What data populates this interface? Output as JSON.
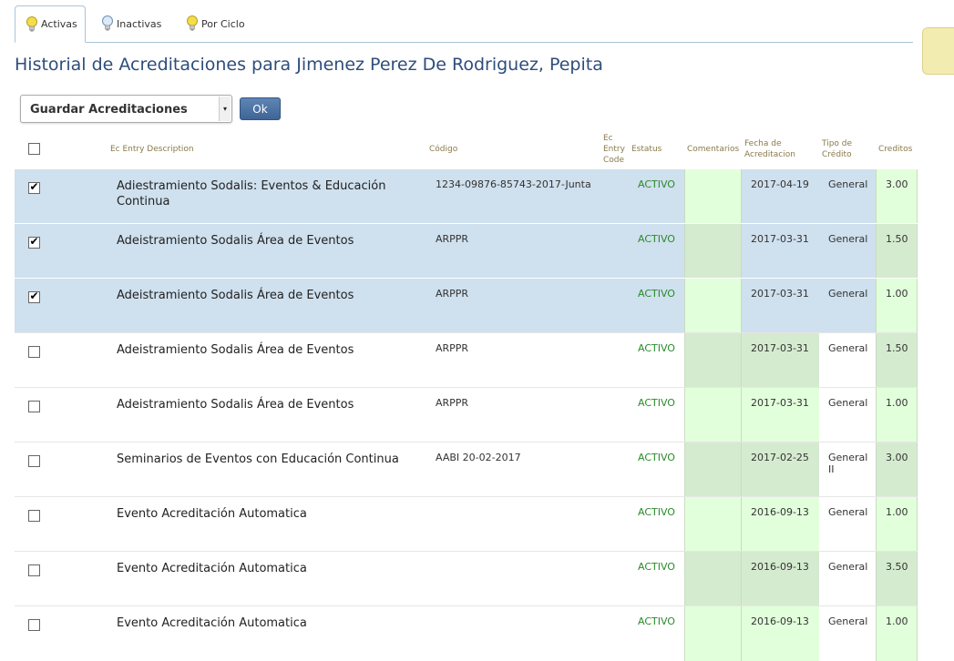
{
  "tabs": [
    {
      "label": "Activas",
      "active": true
    },
    {
      "label": "Inactivas",
      "active": false
    },
    {
      "label": "Por Ciclo",
      "active": false
    }
  ],
  "page_title": "Historial de Acreditaciones para Jimenez Perez De Rodriguez, Pepita",
  "action_select": {
    "value": "Guardar Acreditaciones"
  },
  "ok_label": "Ok",
  "columns": {
    "description": "Ec Entry Description",
    "code": "Código",
    "entry_code": "Ec Entry Code",
    "status": "Estatus",
    "comments": "Comentarios",
    "date": "Fecha de Acreditacion",
    "type": "Tipo de Crédito",
    "credits": "Creditos"
  },
  "colors": {
    "selected_row": "#cfe0ee",
    "green_light": "#e2ffdb",
    "green_dark": "#d5ebcf",
    "status_active": "#2a8a2a",
    "title": "#2e4d7b"
  },
  "rows": [
    {
      "checked": true,
      "description": "Adiestramiento Sodalis: Eventos & Educación Continua",
      "code": "1234-09876-85743-2017-Junta",
      "status": "ACTIVO",
      "comments": "",
      "date": "2017-04-19",
      "type": "General",
      "credits": "3.00"
    },
    {
      "checked": true,
      "description": "Adeistramiento Sodalis Área de Eventos",
      "code": "ARPPR",
      "status": "ACTIVO",
      "comments": "",
      "date": "2017-03-31",
      "type": "General",
      "credits": "1.50"
    },
    {
      "checked": true,
      "description": "Adeistramiento Sodalis Área de Eventos",
      "code": "ARPPR",
      "status": "ACTIVO",
      "comments": "",
      "date": "2017-03-31",
      "type": "General",
      "credits": "1.00"
    },
    {
      "checked": false,
      "description": "Adeistramiento Sodalis Área de Eventos",
      "code": "ARPPR",
      "status": "ACTIVO",
      "comments": "",
      "date": "2017-03-31",
      "type": "General",
      "credits": "1.50"
    },
    {
      "checked": false,
      "description": "Adeistramiento Sodalis Área de Eventos",
      "code": "ARPPR",
      "status": "ACTIVO",
      "comments": "",
      "date": "2017-03-31",
      "type": "General",
      "credits": "1.00"
    },
    {
      "checked": false,
      "description": "Seminarios de Eventos con Educación Continua",
      "code": "AABI 20-02-2017",
      "status": "ACTIVO",
      "comments": "",
      "date": "2017-02-25",
      "type": "General II",
      "credits": "3.00"
    },
    {
      "checked": false,
      "description": "Evento Acreditación Automatica",
      "code": "",
      "status": "ACTIVO",
      "comments": "",
      "date": "2016-09-13",
      "type": "General",
      "credits": "1.00"
    },
    {
      "checked": false,
      "description": "Evento Acreditación Automatica",
      "code": "",
      "status": "ACTIVO",
      "comments": "",
      "date": "2016-09-13",
      "type": "General",
      "credits": "3.50"
    },
    {
      "checked": false,
      "description": "Evento Acreditación Automatica",
      "code": "",
      "status": "ACTIVO",
      "comments": "",
      "date": "2016-09-13",
      "type": "General",
      "credits": "1.00"
    }
  ]
}
